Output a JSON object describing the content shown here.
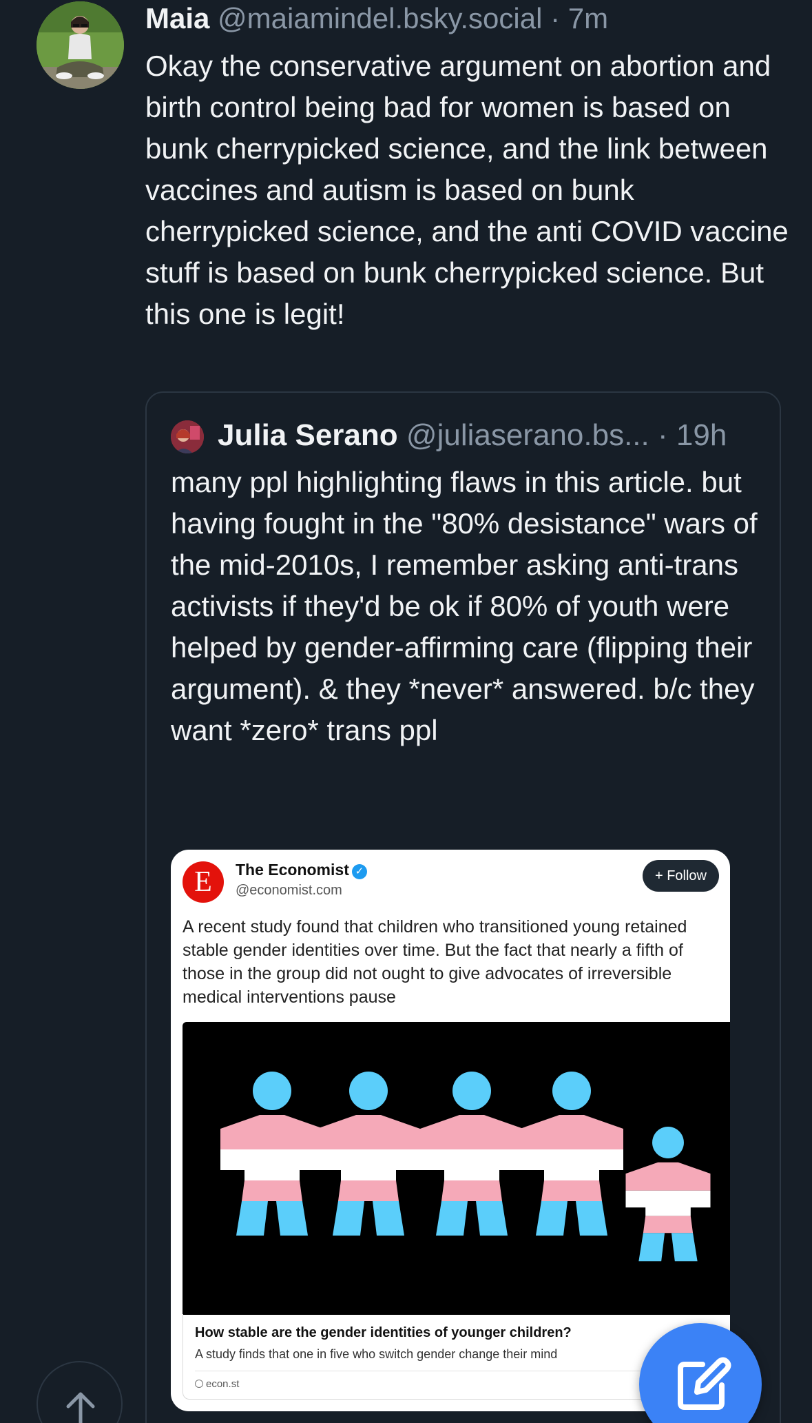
{
  "post": {
    "author_name": "Maia",
    "author_handle": "@maiamindel.bsky.social",
    "separator": "·",
    "time": "7m",
    "text": "Okay the conservative argument on abortion and birth control being bad for women is based on bunk cherrypicked science, and the link between vaccines and autism is based on bunk cherrypicked science, and the anti COVID vaccine stuff is based on bunk cherrypicked science. But this one is legit!"
  },
  "quote": {
    "author_name": "Julia Serano",
    "author_handle": "@juliaserano.bs...",
    "separator": "·",
    "time": "19h",
    "text": "many ppl highlighting flaws in this article. but having fought in the \"80% desistance\" wars of the mid-2010s, I remember asking anti-trans activists if they'd be ok if 80% of youth were helped by gender-affirming care (flipping their argument). & they *never* answered. b/c they want *zero* trans ppl"
  },
  "embed": {
    "logo_letter": "E",
    "account_name": "The Economist",
    "verified_mark": "✓",
    "account_handle": "@economist.com",
    "follow_label": "+ Follow",
    "caption": "A recent study found that children who transitioned young retained stable gender identities over time. But the fact that nearly a fifth of those in the group did not ought to give advocates of irreversible medical interventions pause",
    "image_subject": "paper-doll-chain-trans-flag-colors",
    "link_title": "How stable are the gender identities of younger children?",
    "link_description": "A study finds that one in five who switch gender change their mind",
    "link_domain": "econ.st"
  },
  "controls": {
    "scroll_top_icon": "arrow-up-icon",
    "compose_icon": "compose-icon"
  },
  "colors": {
    "background": "#161e27",
    "text_primary": "#f1f3f5",
    "text_secondary": "#8a97a6",
    "border": "#2b3642",
    "accent": "#3b82f6",
    "trans_blue": "#5bcefa",
    "trans_pink": "#f5a9b8",
    "trans_white": "#ffffff",
    "economist_red": "#e3120b"
  }
}
